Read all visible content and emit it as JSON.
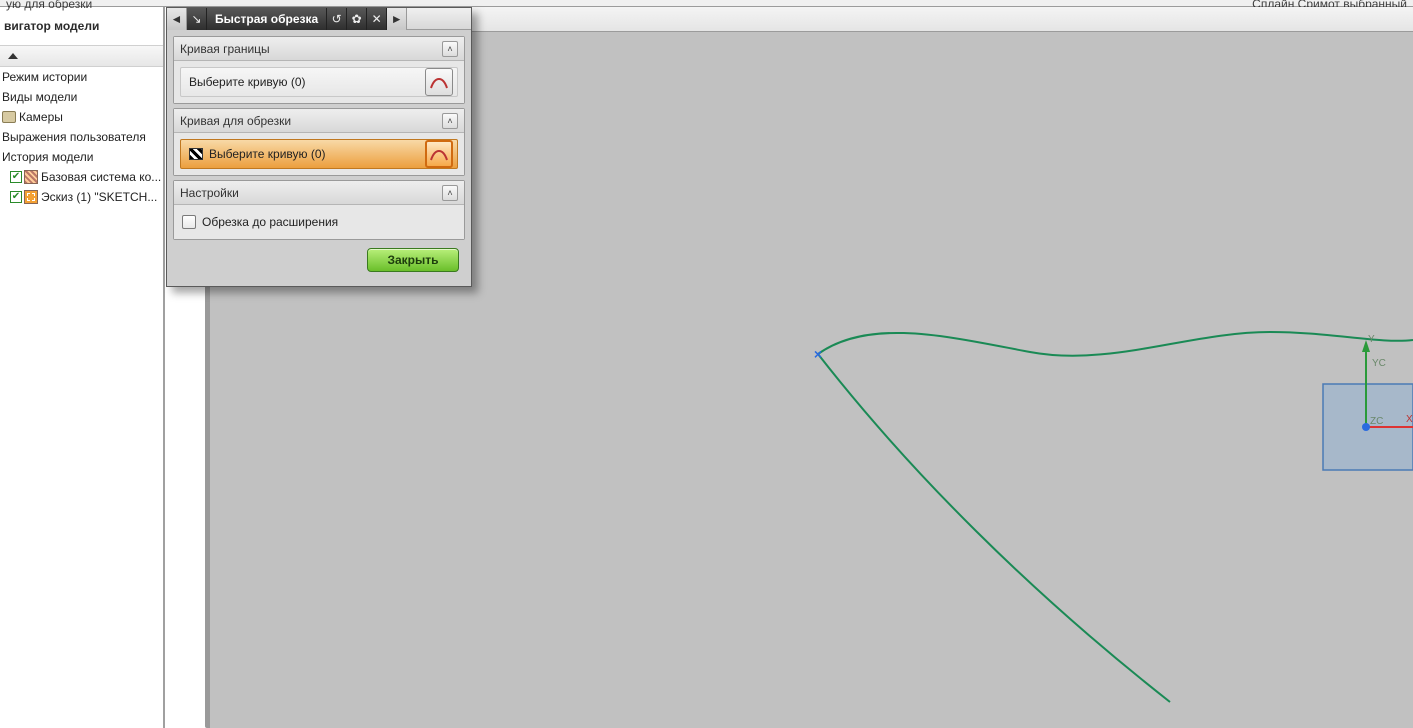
{
  "top": {
    "hint_left": "ую для обрезки",
    "hint_right": "Сплайн  Сримот  выбранный"
  },
  "sidebar": {
    "header": "вигатор модели",
    "items": [
      {
        "label": "Режим истории"
      },
      {
        "label": "Виды модели"
      },
      {
        "label": "Камеры",
        "icon": "cam"
      },
      {
        "label": "Выражения пользователя"
      },
      {
        "label": "История модели"
      },
      {
        "label": "Базовая система ко...",
        "checked": true,
        "icon": "dat",
        "indent": true
      },
      {
        "label": "Эскиз (1) \"SKETCH...",
        "checked": true,
        "icon": "sk",
        "indent": true
      }
    ]
  },
  "dialog": {
    "title": "Быстрая обрезка",
    "groups": {
      "boundary": {
        "title": "Кривая границы",
        "select_label": "Выберите кривую (0)"
      },
      "trim": {
        "title": "Кривая для обрезки",
        "select_label": "Выберите кривую (0)"
      },
      "settings": {
        "title": "Настройки",
        "checkbox_label": "Обрезка до расширения"
      }
    },
    "close_label": "Закрыть"
  },
  "viewport": {
    "axes": {
      "y_label": "YC",
      "z_label": "ZC",
      "x_label": "X",
      "y_top": "Y"
    }
  }
}
